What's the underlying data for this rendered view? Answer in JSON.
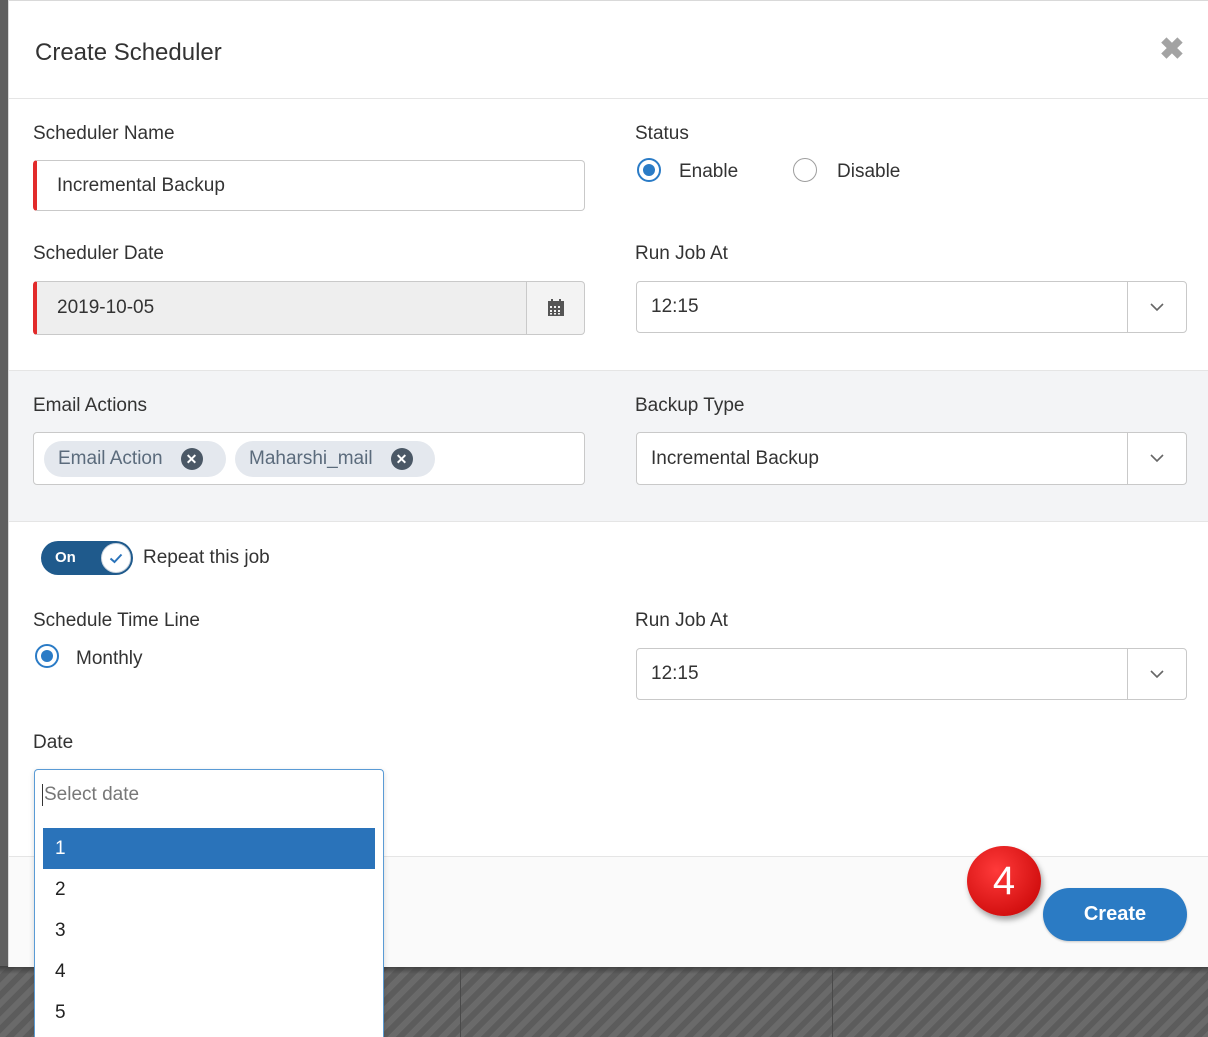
{
  "dialog": {
    "title": "Create Scheduler",
    "close_symbol": "✖"
  },
  "scheduler_name": {
    "label": "Scheduler Name",
    "value": "Incremental Backup"
  },
  "status": {
    "label": "Status",
    "options": [
      {
        "label": "Enable",
        "checked": true
      },
      {
        "label": "Disable",
        "checked": false
      }
    ]
  },
  "scheduler_date": {
    "label": "Scheduler Date",
    "value": "2019-10-05"
  },
  "run_job_at_1": {
    "label": "Run Job At",
    "value": "12:15"
  },
  "email_actions": {
    "label": "Email Actions",
    "tags": [
      "Email Action",
      "Maharshi_mail"
    ]
  },
  "backup_type": {
    "label": "Backup Type",
    "value": "Incremental Backup"
  },
  "repeat": {
    "toggle_label": "On",
    "label": "Repeat this job",
    "on": true
  },
  "schedule_time_line": {
    "label": "Schedule Time Line",
    "option": "Monthly"
  },
  "run_job_at_2": {
    "label": "Run Job At",
    "value": "12:15"
  },
  "date": {
    "label": "Date",
    "placeholder": "Select date",
    "options": [
      "1",
      "2",
      "3",
      "4",
      "5"
    ],
    "selected": "1"
  },
  "actions": {
    "create_label": "Create",
    "step_number": "4"
  },
  "colors": {
    "accent": "#2b7bc4",
    "invalid": "#e22b2b",
    "badge": "#d40000"
  }
}
